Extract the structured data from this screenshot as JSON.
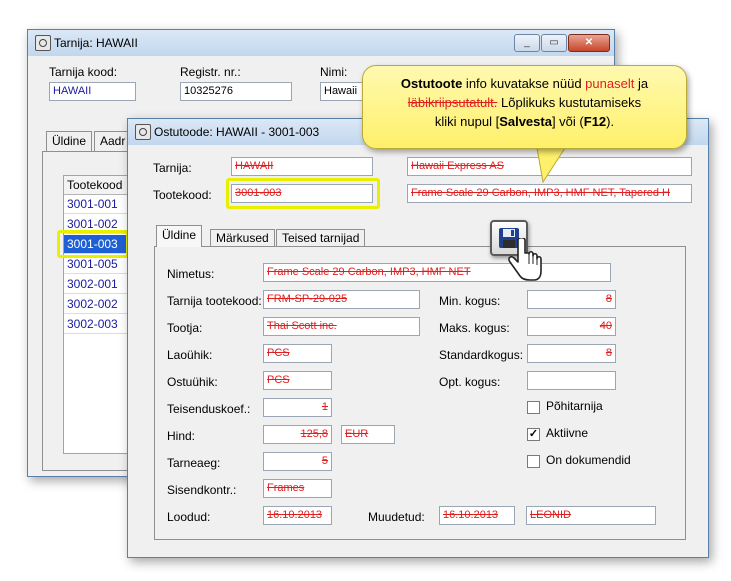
{
  "back_window": {
    "title": "Tarnija: HAWAII",
    "labels": {
      "code": "Tarnija kood:",
      "regnr": "Registr. nr.:",
      "name": "Nimi:"
    },
    "values": {
      "code": "HAWAII",
      "regnr": "10325276",
      "name": "Hawaii"
    },
    "tabs": [
      "Üldine",
      "Aadr"
    ],
    "list_header": "Tootekood",
    "list_items": [
      "3001-001",
      "3001-002",
      "3001-003",
      "3001-005",
      "3002-001",
      "3002-002",
      "3002-003"
    ]
  },
  "front_window": {
    "title": "Ostutoode: HAWAII - 3001-003",
    "supplier_label": "Tarnija:",
    "supplier_code": "HAWAII",
    "supplier_name": "Hawaii Express AS",
    "product_label": "Tootekood:",
    "product_code": "3001-003",
    "product_desc": "Frame Scale 29 Carbon, IMP3, HMF NET, Tapered H",
    "tabs": [
      "Üldine",
      "Märkused",
      "Teised tarnijad"
    ],
    "fields": {
      "nimetus_label": "Nimetus:",
      "nimetus": "Frame Scale 29 Carbon, IMP3, HMF NET",
      "tarnija_tootekood_label": "Tarnija tootekood:",
      "tarnija_tootekood": "FRM-SP-29-025",
      "tootja_label": "Tootja:",
      "tootja": "Thai Scott inc.",
      "laouhik_label": "Laoühik:",
      "laouhik": "PCS",
      "ostuuhik_label": "Ostuühik:",
      "ostuuhik": "PCS",
      "teisenduskoef_label": "Teisenduskoef.:",
      "teisenduskoef": "1",
      "hind_label": "Hind:",
      "hind": "125,8",
      "currency": "EUR",
      "tarneaeg_label": "Tarneaeg:",
      "tarneaeg": "5",
      "sisendkontr_label": "Sisendkontr.:",
      "sisendkontr": "Frames",
      "loodud_label": "Loodud:",
      "loodud": "16.10.2013",
      "muudetud_label": "Muudetud:",
      "muudetud": "16.10.2013",
      "muudetud_user": "LEONID",
      "min_kogus_label": "Min. kogus:",
      "min_kogus": "8",
      "maks_kogus_label": "Maks. kogus:",
      "maks_kogus": "40",
      "standardkogus_label": "Standardkogus:",
      "standardkogus": "8",
      "opt_kogus_label": "Opt. kogus:",
      "opt_kogus": ""
    },
    "checkboxes": [
      {
        "label": "Põhitarnija",
        "checked": false
      },
      {
        "label": "Aktiivne",
        "checked": true
      },
      {
        "label": "On dokumendid",
        "checked": false
      }
    ]
  },
  "tooltip": {
    "part1": "Ostutoote",
    "part2": " info kuvatakse nüüd ",
    "part3": "punaselt",
    "part4": " ja",
    "part5": "läbikriipsutatult.",
    "part6": " Lõplikuks kustutamiseks",
    "part7": "kliki nupul  [",
    "part8": "Salvesta",
    "part9": "] või (",
    "part10": "F12",
    "part11": ")."
  },
  "colors": {
    "deleted": "#e02020",
    "highlight": "#e8f000",
    "selected_row": "#1f5fd6"
  }
}
